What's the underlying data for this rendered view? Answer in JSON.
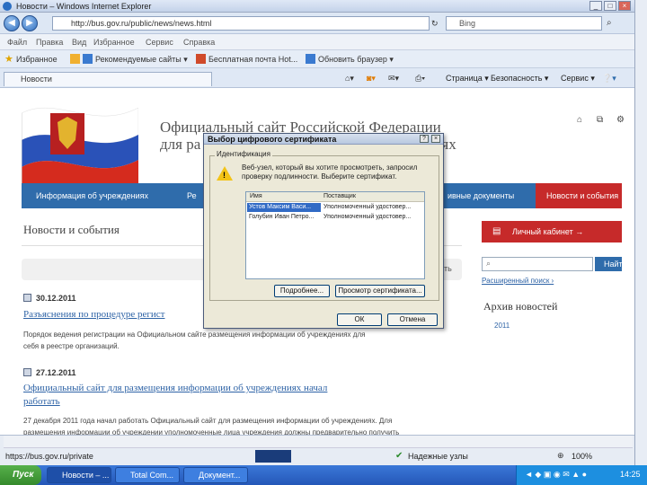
{
  "window": {
    "title": "Новости – Windows Internet Explorer",
    "buttons": [
      "_",
      "□",
      "×"
    ]
  },
  "address": {
    "url": "http://bus.gov.ru/public/news/news.html",
    "search_placeholder": "Bing"
  },
  "menu": [
    "Файл",
    "Правка",
    "Вид",
    "Избранное",
    "Сервис",
    "Справка"
  ],
  "favorites": {
    "label": "Избранное",
    "items": [
      "Рекомендуемые сайты ▾",
      "Бесплатная почта Hot...",
      "Обновить браузер ▾"
    ]
  },
  "tab": {
    "label": "Новости"
  },
  "commands": [
    "Страница ▾",
    "Безопасность ▾",
    "Сервис ▾"
  ],
  "site": {
    "title_line1": "Официальный сайт Российской Федерации",
    "title_line2_left": "для ра",
    "title_line2_right": "ждениях",
    "nav": {
      "item1": "Информация об учреждениях",
      "item2": "Ре",
      "item3": "ивные документы",
      "item4": "Новости и события"
    },
    "news_heading": "Новости и события",
    "filter_right": "ть",
    "news": [
      {
        "date": "30.12.2011",
        "title": "Разъяснения по процедуре регист",
        "body1": "Порядок ведения регистрации на Официальном сайте размещения информации об учреждениях для",
        "body2": "себя в реестре организаций."
      },
      {
        "date": "27.12.2011",
        "title1": "Официальный сайт для размещения информации об учреждениях начал",
        "title2": "работать",
        "body1": "27 декабря 2011 года начал работать Официальный сайт для размещения информации об учреждениях. Для",
        "body2": "размещения информации об учреждении уполномоченные лица учреждения должны предварительно получить"
      }
    ],
    "cabinet": "Личный кабинет →",
    "search_btn": "Найти",
    "ext_search": "Расширенный поиск ›",
    "archive_heading": "Архив новостей",
    "archive_year": "2011"
  },
  "dialog": {
    "title": "Выбор цифрового сертификата",
    "group_label": "Идентификация",
    "message": "Веб-узел, который вы хотите просмотреть, запросил проверку подлинности. Выберите сертификат.",
    "columns": [
      "Имя",
      "Поставщик"
    ],
    "rows": [
      [
        "Устов Максим Васи...",
        "Уполномоченный удостовер..."
      ],
      [
        "Голубин Иван Петро...",
        "Уполномоченный удостовер..."
      ]
    ],
    "btn_more": "Подробнее...",
    "btn_view": "Просмотр сертификата...",
    "btn_ok": "ОК",
    "btn_cancel": "Отмена"
  },
  "status": {
    "url": "https://bus.gov.ru/private",
    "zone": "Надежные узлы",
    "zoom": "100%"
  },
  "taskbar": {
    "start": "Пуск",
    "tasks": [
      "Новости – ...",
      "Total Com...",
      "Документ..."
    ],
    "clock": "14:25"
  },
  "colors": {
    "nav_blue": "#2f6cab",
    "news_red": "#c62a2a",
    "link": "#2e63a6"
  }
}
